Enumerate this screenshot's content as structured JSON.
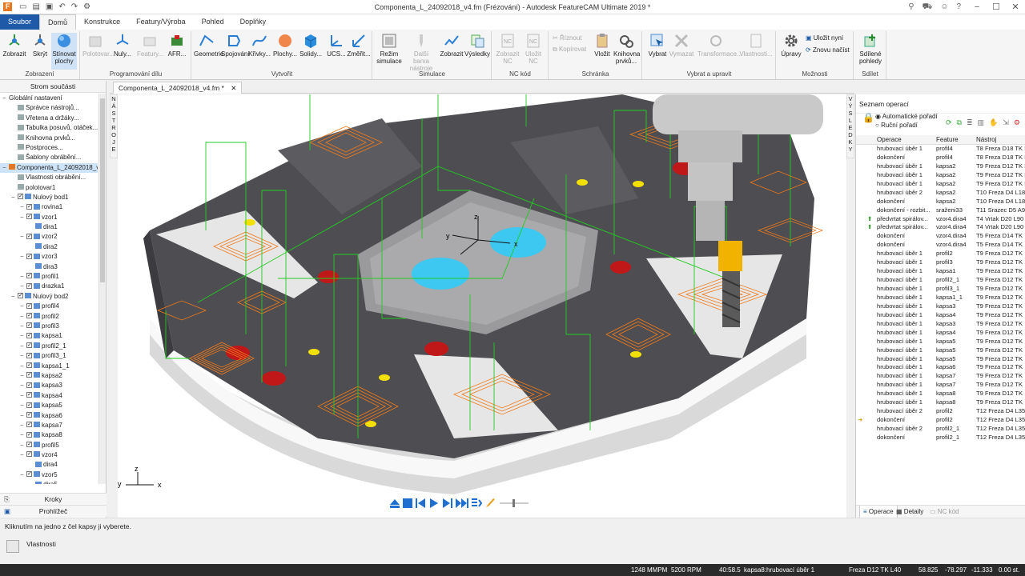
{
  "window": {
    "app_icon": "F",
    "title": "Componenta_L_24092018_v4.fm (Frézování) - Autodesk FeatureCAM Ultimate 2019 *",
    "controls": [
      "−",
      "☐",
      "✕"
    ]
  },
  "ribbon_tabs": [
    "Soubor",
    "Domů",
    "Konstrukce",
    "Featury/Výroba",
    "Pohled",
    "Doplňky"
  ],
  "ribbon": {
    "zobrazeni": {
      "label": "Zobrazení",
      "buttons": [
        "Zobrazit",
        "Skrýt",
        "Stínovat plochy"
      ]
    },
    "programovani": {
      "label": "Programování dílu",
      "buttons": [
        "Polotovar...",
        "Nuly...",
        "Featury...",
        "AFR..."
      ]
    },
    "vytvorit": {
      "label": "Vytvořit",
      "buttons": [
        "Geometrie",
        "Spojování",
        "Křivky...",
        "Plochy...",
        "Solidy...",
        "UCS...",
        "Změřit..."
      ]
    },
    "simulace": {
      "label": "Simulace",
      "buttons": [
        "Režim simulace",
        "Další barva nástroje",
        "Zobrazit",
        "Výsledky"
      ]
    },
    "nc": {
      "label": "NC kód",
      "buttons": [
        "Zobrazit NC",
        "Uložit NC"
      ]
    },
    "schranka": {
      "label": "Schránka",
      "buttons": [
        "Vložit",
        "Knihovna prvků...",
        "Říznout",
        "Kopírovat"
      ]
    },
    "vybrat": {
      "label": "Vybrat a upravit",
      "buttons": [
        "Vybrat",
        "Vymazat",
        "Transformace...",
        "Vlastnosti..."
      ]
    },
    "moznosti": {
      "label": "Možnosti",
      "buttons": [
        "Úpravy",
        "Uložit nyní",
        "Znovu načíst"
      ]
    },
    "sdilet": {
      "label": "Sdílet",
      "buttons": [
        "Sdílené pohledy"
      ]
    }
  },
  "left_panel": {
    "title": "Strom součásti",
    "tree": [
      {
        "label": "Globální nastavení",
        "indent": 0,
        "kind": "minus"
      },
      {
        "label": "Správce nástrojů...",
        "indent": 1,
        "kind": "icon"
      },
      {
        "label": "Vřetena a držáky...",
        "indent": 1,
        "kind": "icon"
      },
      {
        "label": "Tabulka posuvů, otáček...",
        "indent": 1,
        "kind": "icon"
      },
      {
        "label": "Knihovna prvků...",
        "indent": 1,
        "kind": "icon"
      },
      {
        "label": "Postproces...",
        "indent": 1,
        "kind": "icon"
      },
      {
        "label": "Šablony obrábění...",
        "indent": 1,
        "kind": "icon"
      },
      {
        "label": "Componenta_L_24092018_v4...",
        "indent": 0,
        "kind": "doc",
        "selected": true
      },
      {
        "label": "Vlastnosti obrábění...",
        "indent": 1,
        "kind": "icon"
      },
      {
        "label": "polotovar1",
        "indent": 1,
        "kind": "icon"
      },
      {
        "label": "Nulový bod1",
        "indent": 1,
        "kind": "check"
      },
      {
        "label": "rovina1",
        "indent": 2,
        "kind": "check"
      },
      {
        "label": "vzor1",
        "indent": 2,
        "kind": "check"
      },
      {
        "label": "dira1",
        "indent": 3,
        "kind": "feat"
      },
      {
        "label": "vzor2",
        "indent": 2,
        "kind": "check"
      },
      {
        "label": "dira2",
        "indent": 3,
        "kind": "feat"
      },
      {
        "label": "vzor3",
        "indent": 2,
        "kind": "check"
      },
      {
        "label": "dira3",
        "indent": 3,
        "kind": "feat"
      },
      {
        "label": "profil1",
        "indent": 2,
        "kind": "check"
      },
      {
        "label": "drazka1",
        "indent": 2,
        "kind": "check"
      },
      {
        "label": "Nulový bod2",
        "indent": 1,
        "kind": "check"
      },
      {
        "label": "profil4",
        "indent": 2,
        "kind": "check"
      },
      {
        "label": "profil2",
        "indent": 2,
        "kind": "check"
      },
      {
        "label": "profil3",
        "indent": 2,
        "kind": "check"
      },
      {
        "label": "kapsa1",
        "indent": 2,
        "kind": "check"
      },
      {
        "label": "profil2_1",
        "indent": 2,
        "kind": "check"
      },
      {
        "label": "profil3_1",
        "indent": 2,
        "kind": "check"
      },
      {
        "label": "kapsa1_1",
        "indent": 2,
        "kind": "check"
      },
      {
        "label": "kapsa2",
        "indent": 2,
        "kind": "check"
      },
      {
        "label": "kapsa3",
        "indent": 2,
        "kind": "check"
      },
      {
        "label": "kapsa4",
        "indent": 2,
        "kind": "check"
      },
      {
        "label": "kapsa5",
        "indent": 2,
        "kind": "check"
      },
      {
        "label": "kapsa6",
        "indent": 2,
        "kind": "check"
      },
      {
        "label": "kapsa7",
        "indent": 2,
        "kind": "check"
      },
      {
        "label": "kapsa8",
        "indent": 2,
        "kind": "check"
      },
      {
        "label": "profil5",
        "indent": 2,
        "kind": "check"
      },
      {
        "label": "vzor4",
        "indent": 2,
        "kind": "check"
      },
      {
        "label": "dira4",
        "indent": 3,
        "kind": "feat"
      },
      {
        "label": "vzor5",
        "indent": 2,
        "kind": "check"
      },
      {
        "label": "dira5",
        "indent": 3,
        "kind": "feat"
      }
    ],
    "footer": [
      "Kroky",
      "Prohlížeč"
    ]
  },
  "doc_tab": "Componenta_L_24092018_v4.fm *",
  "side_strips": {
    "left": "NÁSTROJE",
    "right": "VÝSLEDKY"
  },
  "viewport": {
    "axes": {
      "x": "x",
      "y": "y",
      "z": "z"
    }
  },
  "right_panel": {
    "title": "Seznam operací",
    "options": [
      "Automatické pořadí",
      "Ruční pořadí"
    ],
    "columns": [
      "Operace",
      "Feature",
      "Nástroj"
    ],
    "rows": [
      [
        "hrubovací úběr 1",
        "profil4",
        "T8 Freza D18 TK L"
      ],
      [
        "dokončení",
        "profil4",
        "T8 Freza D18 TK L"
      ],
      [
        "hrubovací úběr 1",
        "kapsa2",
        "T9 Freza D12 TK L"
      ],
      [
        "hrubovací úběr 1",
        "kapsa2",
        "T9 Freza D12 TK L"
      ],
      [
        "hrubovací úběr 1",
        "kapsa2",
        "T9 Freza D12 TK L"
      ],
      [
        "hrubovací úběr 2",
        "kapsa2",
        "T10 Freza D4 L18"
      ],
      [
        "dokončení",
        "kapsa2",
        "T10 Freza D4 L18"
      ],
      [
        "dokončení - rozbit...",
        "sraženi33",
        "T11 Srazec D5 A9"
      ],
      [
        "předvrtat spirálov...",
        "vzor4.dira4",
        "T4 Vrtak D20 L90"
      ],
      [
        "předvrtat spirálov...",
        "vzor4.dira4",
        "T4 Vrtak D20 L90"
      ],
      [
        "dokončení",
        "vzor4.dira4",
        "T5 Freza D14 TK"
      ],
      [
        "dokončení",
        "vzor4.dira4",
        "T5 Freza D14 TK"
      ],
      [
        "hrubovací úběr 1",
        "profil2",
        "T9 Freza D12 TK"
      ],
      [
        "hrubovací úběr 1",
        "profil3",
        "T9 Freza D12 TK"
      ],
      [
        "hrubovací úběr 1",
        "kapsa1",
        "T9 Freza D12 TK"
      ],
      [
        "hrubovací úběr 1",
        "profil2_1",
        "T9 Freza D12 TK"
      ],
      [
        "hrubovací úběr 1",
        "profil3_1",
        "T9 Freza D12 TK"
      ],
      [
        "hrubovací úběr 1",
        "kapsa1_1",
        "T9 Freza D12 TK"
      ],
      [
        "hrubovací úběr 1",
        "kapsa3",
        "T9 Freza D12 TK"
      ],
      [
        "hrubovací úběr 1",
        "kapsa4",
        "T9 Freza D12 TK"
      ],
      [
        "hrubovací úběr 1",
        "kapsa3",
        "T9 Freza D12 TK"
      ],
      [
        "hrubovací úběr 1",
        "kapsa4",
        "T9 Freza D12 TK"
      ],
      [
        "hrubovací úběr 1",
        "kapsa5",
        "T9 Freza D12 TK"
      ],
      [
        "hrubovací úběr 1",
        "kapsa5",
        "T9 Freza D12 TK"
      ],
      [
        "hrubovací úběr 1",
        "kapsa5",
        "T9 Freza D12 TK"
      ],
      [
        "hrubovací úběr 1",
        "kapsa6",
        "T9 Freza D12 TK"
      ],
      [
        "hrubovací úběr 1",
        "kapsa7",
        "T9 Freza D12 TK"
      ],
      [
        "hrubovací úběr 1",
        "kapsa7",
        "T9 Freza D12 TK"
      ],
      [
        "hrubovací úběr 1",
        "kapsa8",
        "T9 Freza D12 TK"
      ],
      [
        "hrubovací úběr 1",
        "kapsa8",
        "T9 Freza D12 TK"
      ],
      [
        "hrubovací úběr 2",
        "profil2",
        "T12 Freza D4 L35"
      ],
      [
        "dokončení",
        "profil2",
        "T12 Freza D4 L35"
      ],
      [
        "hrubovací úběr 2",
        "profil2_1",
        "T12 Freza D4 L35"
      ],
      [
        "dokončení",
        "profil2_1",
        "T12 Freza D4 L35"
      ]
    ],
    "footer_tabs": [
      "Operace",
      "Detaily",
      "NC kód"
    ]
  },
  "status_message": "Kliknutím na jedno z čel kapsy ji vyberete.",
  "properties_label": "Vlastnosti",
  "statusbar": {
    "feed": "1248 MMPM",
    "speed": "5200 RPM",
    "time": "40:58.5",
    "op": "kapsa8:hrubovací úběr 1",
    "tool": "Freza D12 TK L40",
    "x": "58.825",
    "y": "-78.297",
    "z": "-11.333",
    "extra": "0.00 st."
  },
  "colors": {
    "accent": "#1e5aa8",
    "toolpath": "#f07a1a",
    "rapid": "#22cc22",
    "part": "#4a4a4e",
    "hole": "#c01818",
    "cyan": "#3cc8f0"
  }
}
